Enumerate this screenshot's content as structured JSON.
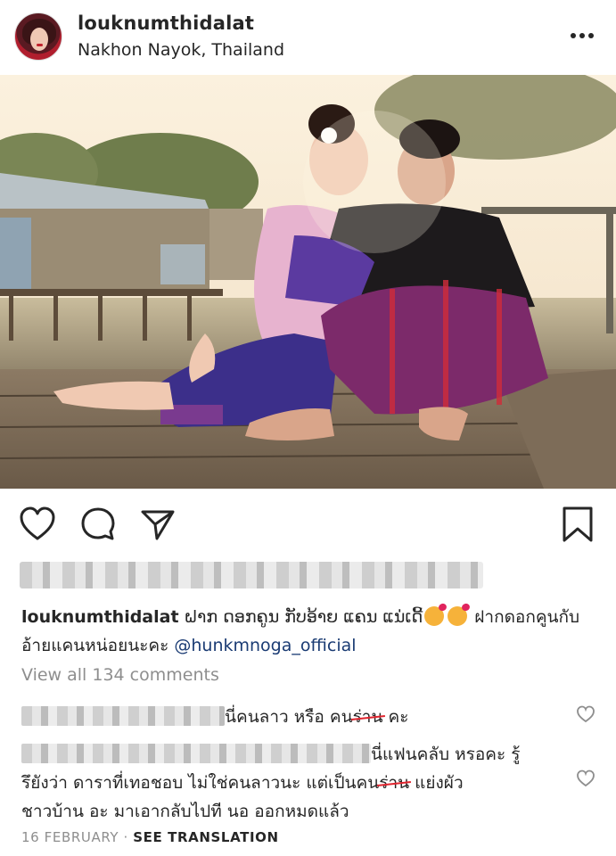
{
  "post": {
    "username": "louknumthidalat",
    "location": "Nakhon Nayok, Thailand",
    "caption_user": "louknumthidalat",
    "caption_text_1": " ຝາກ ດອກຄູນ ກັບອ້າຍ ແຄນ ແນ່ເດີ້",
    "caption_text_2": " ฝากดอกคูนกับอ้ายแคนหน่อยนะคะ ",
    "caption_mention": "@hunkmnoga_official",
    "view_all_comments": "View all 134 comments",
    "date": "16 FEBRUARY",
    "separator": " · ",
    "see_translation": "SEE TRANSLATION"
  },
  "comments": [
    {
      "text_before": "นี่คนลาว หรือ คน",
      "struck": "ร่าน",
      "text_after": " คะ"
    },
    {
      "line1": "นี่แฟนคลับ หรอคะ รู้",
      "line2_before": "รึยังว่า ดาราที่เทอชอบ ไม่ใช่คนลาวนะ แต่เป็นคน",
      "struck": "ร่าน",
      "line2_after": " แย่งผัว",
      "line3": "ชาวบ้าน อะ มาเอากลับไปที นอ ออกหมดแล้ว"
    }
  ],
  "colors": {
    "text": "#262626",
    "muted": "#8e8e8e",
    "mention": "#1a3b73",
    "strike": "#e0242e"
  },
  "icons": [
    "more-icon",
    "heart-icon",
    "comment-icon",
    "share-icon",
    "bookmark-icon",
    "small-heart-icon"
  ]
}
